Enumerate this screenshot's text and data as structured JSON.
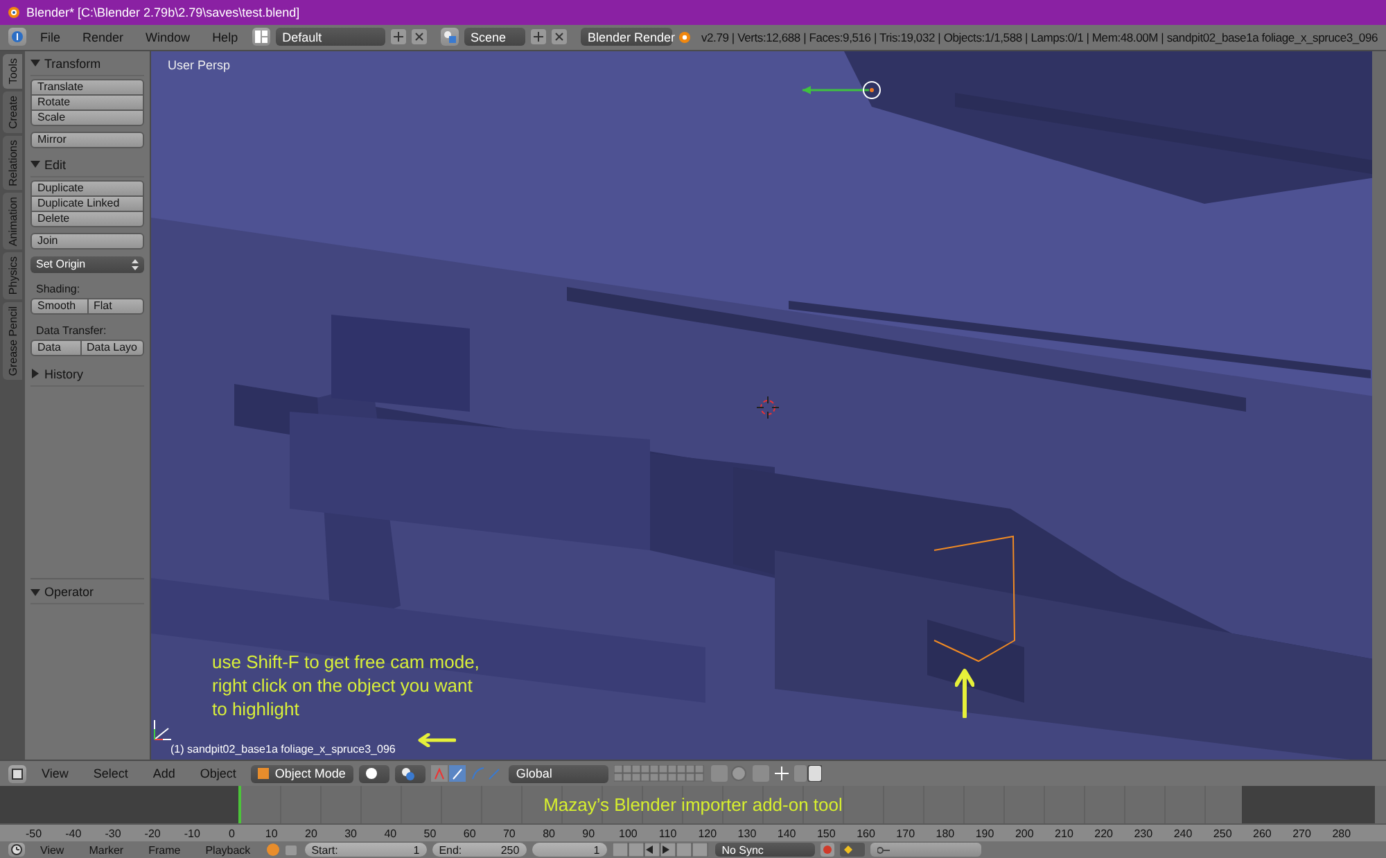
{
  "window": {
    "title": "Blender* [C:\\Blender 2.79b\\2.79\\saves\\test.blend]"
  },
  "header": {
    "menus": [
      "File",
      "Render",
      "Window",
      "Help"
    ],
    "layout": "Default",
    "scene": "Scene",
    "engine": "Blender Render",
    "stats": "v2.79 | Verts:12,688 | Faces:9,516 | Tris:19,032 | Objects:1/1,588 | Lamps:0/1 | Mem:48.00M | sandpit02_base1a foliage_x_spruce3_096"
  },
  "tool_tabs": [
    {
      "label": "Tools",
      "selected": true
    },
    {
      "label": "Create",
      "selected": false
    },
    {
      "label": "Relations",
      "selected": false
    },
    {
      "label": "Animation",
      "selected": false
    },
    {
      "label": "Physics",
      "selected": false
    },
    {
      "label": "Grease Pencil",
      "selected": false
    }
  ],
  "tool_panel": [
    {
      "title": "Transform",
      "expanded": true,
      "items": [
        {
          "kind": "group",
          "buttons": [
            "Translate",
            "Rotate",
            "Scale"
          ]
        },
        {
          "kind": "group",
          "buttons": [
            "Mirror"
          ]
        }
      ]
    },
    {
      "title": "Edit",
      "expanded": true,
      "items": [
        {
          "kind": "group",
          "buttons": [
            "Duplicate",
            "Duplicate Linked",
            "Delete"
          ]
        },
        {
          "kind": "group",
          "buttons": [
            "Join"
          ]
        },
        {
          "kind": "dropdown",
          "label": "Set Origin"
        },
        {
          "kind": "label",
          "label": "Shading:"
        },
        {
          "kind": "row",
          "buttons": [
            "Smooth",
            "Flat"
          ]
        },
        {
          "kind": "label",
          "label": "Data Transfer:"
        },
        {
          "kind": "row",
          "buttons": [
            "Data",
            "Data Layo"
          ]
        }
      ]
    },
    {
      "title": "History",
      "expanded": false
    }
  ],
  "operator": {
    "title": "Operator",
    "expanded": true
  },
  "viewport": {
    "view_name": "User Persp",
    "object_label": "(1) sandpit02_base1a foliage_x_spruce3_096",
    "annotation_lines": [
      "use Shift-F to get free cam mode,",
      "right click on the object you want",
      "to highlight"
    ]
  },
  "view_header": {
    "menus": [
      "View",
      "Select",
      "Add",
      "Object"
    ],
    "mode": "Object Mode",
    "orientation": "Global"
  },
  "timeline": {
    "caption": "Mazay’s Blender importer add-on tool",
    "ticks": [
      "-50",
      "-40",
      "-30",
      "-20",
      "-10",
      "0",
      "10",
      "20",
      "30",
      "40",
      "50",
      "60",
      "70",
      "80",
      "90",
      "100",
      "110",
      "120",
      "130",
      "140",
      "150",
      "160",
      "170",
      "180",
      "190",
      "200",
      "210",
      "220",
      "230",
      "240",
      "250",
      "260",
      "270",
      "280"
    ]
  },
  "timeline_header": {
    "menus": [
      "View",
      "Marker",
      "Frame",
      "Playback"
    ],
    "start_label": "Start:",
    "start": "1",
    "end_label": "End:",
    "end": "250",
    "current": "1",
    "sync": "No Sync"
  }
}
